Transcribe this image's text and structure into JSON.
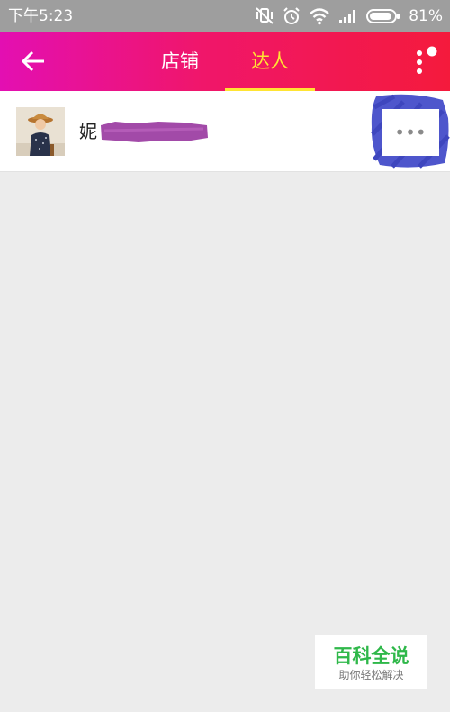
{
  "status_bar": {
    "time": "下午5:23",
    "battery": "81%",
    "icons": [
      "vibrate-off-icon",
      "alarm-icon",
      "wifi-icon",
      "signal-icon",
      "battery-icon"
    ]
  },
  "header": {
    "back_icon": "arrow-left-icon",
    "tabs": [
      {
        "label": "店铺",
        "active": false
      },
      {
        "label": "达人",
        "active": true
      }
    ],
    "active_color": "#ffe433",
    "gradient": [
      "#e30fb2",
      "#f41a3c"
    ],
    "menu_icon": "more-vertical-icon"
  },
  "list": {
    "items": [
      {
        "name": "妮",
        "more_label": "•••"
      }
    ]
  },
  "watermark": {
    "title": "百科全说",
    "tagline": "助你轻松解决",
    "color": "#2fb84a"
  }
}
